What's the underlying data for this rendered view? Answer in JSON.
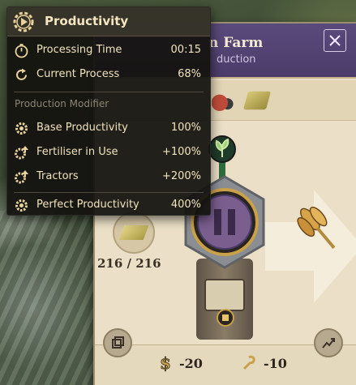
{
  "tooltip": {
    "title": "Productivity",
    "header_icon": "productivity-gear-icon",
    "rows": [
      {
        "label": "Processing Time",
        "value": "00:15",
        "icon": "stopwatch-icon"
      },
      {
        "label": "Current Process",
        "value": "68%",
        "icon": "refresh-arrow-icon"
      }
    ],
    "section_label": "Production Modifier",
    "modifiers": [
      {
        "label": "Base Productivity",
        "value": "100%",
        "icon": "gear-productivity-icon"
      },
      {
        "label": "Fertiliser in Use",
        "value": "+100%",
        "icon": "gear-boost-icon"
      },
      {
        "label": "Tractors",
        "value": "+200%",
        "icon": "gear-boost-icon"
      }
    ],
    "total": {
      "label": "Perfect Productivity",
      "value": "400%",
      "icon": "gear-productivity-icon"
    }
  },
  "panel": {
    "title_fragment": "n Farm",
    "subtitle_fragment": "duction",
    "header_color": "#4b3c6a",
    "stock": "216 / 216",
    "costs": [
      {
        "icon": "money-icon",
        "value": "-20"
      },
      {
        "icon": "workforce-icon",
        "value": "-10"
      }
    ],
    "pause_icon": "pause-icon",
    "output_icon": "wheat-icon",
    "input_icon": "hay-icon",
    "goods_icons": [
      "tractor-icon",
      "hay-icon"
    ]
  },
  "colors": {
    "accent_gold": "#c9a14a",
    "tooltip_bg": "#141310",
    "tooltip_text": "#f1e3bd",
    "panel_bg": "#ebe0c7"
  }
}
